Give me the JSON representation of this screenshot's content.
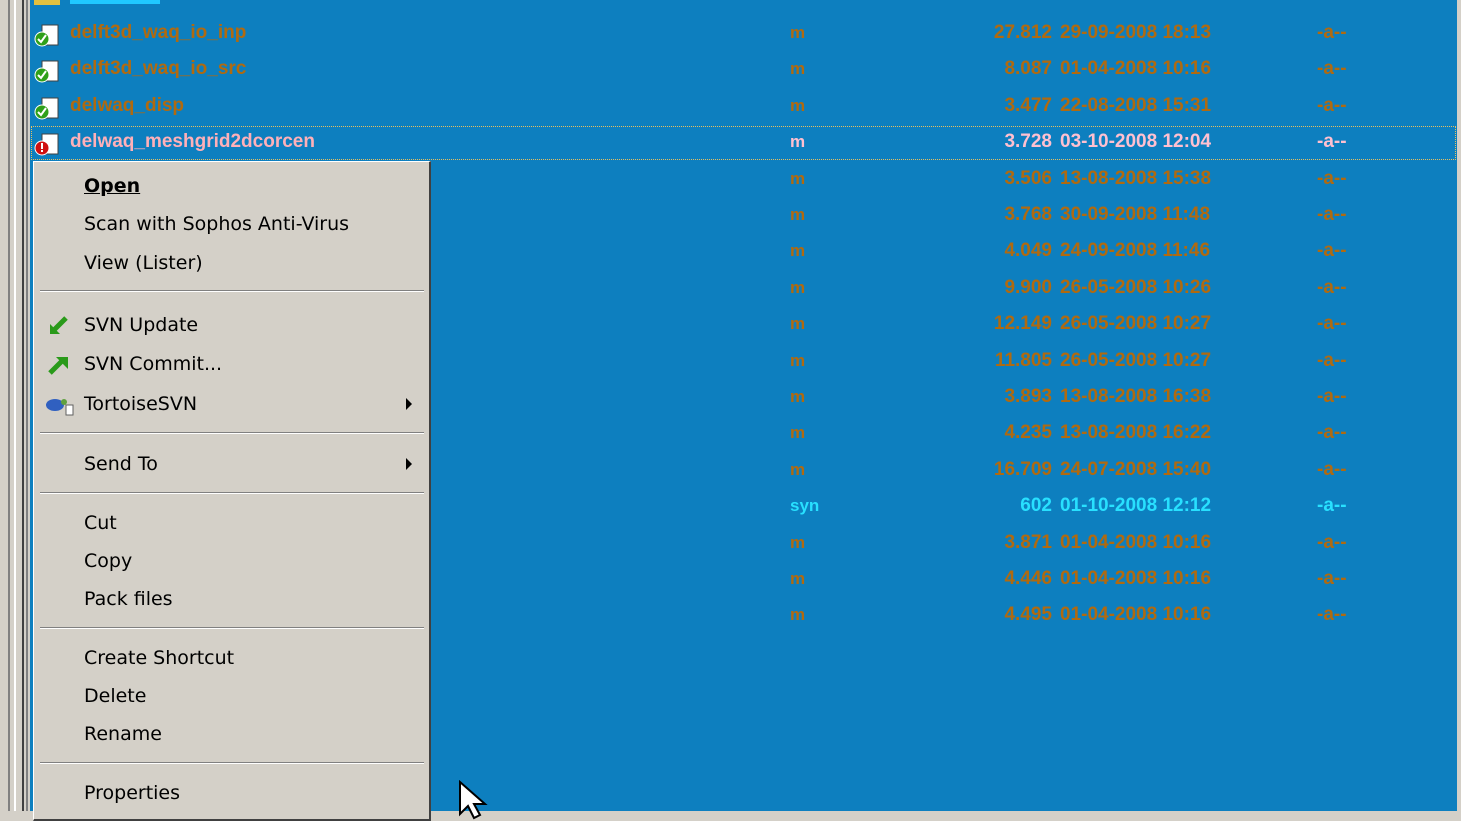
{
  "file_rows": [
    {
      "name": "delft3d_waq_io_inp",
      "ext": "m",
      "size": "27.812",
      "date": "29-09-2008 18:13",
      "attr": "-a--",
      "icon": "svn-normal-icon"
    },
    {
      "name": "delft3d_waq_io_src",
      "ext": "m",
      "size": "8.087",
      "date": "01-04-2008 10:16",
      "attr": "-a--",
      "icon": "svn-normal-icon"
    },
    {
      "name": "delwaq_disp",
      "ext": "m",
      "size": "3.477",
      "date": "22-08-2008 15:31",
      "attr": "-a--",
      "icon": "svn-normal-icon"
    },
    {
      "name": "delwaq_meshgrid2dcorcen",
      "ext": "m",
      "size": "3.728",
      "date": "03-10-2008 12:04",
      "attr": "-a--",
      "icon": "svn-modified-icon"
    },
    {
      "name": "",
      "ext": "m",
      "size": "3.506",
      "date": "13-08-2008 15:38",
      "attr": "-a--"
    },
    {
      "name": "",
      "ext": "m",
      "size": "3.768",
      "date": "30-09-2008 11:48",
      "attr": "-a--"
    },
    {
      "name": "",
      "ext": "m",
      "size": "4.049",
      "date": "24-09-2008 11:46",
      "attr": "-a--"
    },
    {
      "name": "",
      "ext": "m",
      "size": "9.900",
      "date": "26-05-2008 10:26",
      "attr": "-a--"
    },
    {
      "name": "",
      "ext": "m",
      "size": "12.149",
      "date": "26-05-2008 10:27",
      "attr": "-a--"
    },
    {
      "name": "",
      "ext": "m",
      "size": "11.805",
      "date": "26-05-2008 10:27",
      "attr": "-a--"
    },
    {
      "name": "",
      "ext": "m",
      "size": "3.893",
      "date": "13-08-2008 16:38",
      "attr": "-a--"
    },
    {
      "name": "",
      "ext": "m",
      "size": "4.235",
      "date": "13-08-2008 16:22",
      "attr": "-a--"
    },
    {
      "name": "",
      "ext": "m",
      "size": "16.709",
      "date": "24-07-2008 15:40",
      "attr": "-a--"
    },
    {
      "name": "",
      "ext": "syn",
      "size": "602",
      "date": "01-10-2008 12:12",
      "attr": "-a--"
    },
    {
      "name": "",
      "ext": "m",
      "size": "3.871",
      "date": "01-04-2008 10:16",
      "attr": "-a--"
    },
    {
      "name": "",
      "ext": "m",
      "size": "4.446",
      "date": "01-04-2008 10:16",
      "attr": "-a--"
    },
    {
      "name": "",
      "ext": "m",
      "size": "4.495",
      "date": "01-04-2008 10:16",
      "attr": "-a--"
    }
  ],
  "context_menu": {
    "open": "Open",
    "scan": "Scan with Sophos Anti-Virus",
    "view": "View (Lister)",
    "svn_update": "SVN Update",
    "svn_commit": "SVN Commit...",
    "tortoise": "TortoiseSVN",
    "send_to": "Send To",
    "cut": "Cut",
    "copy": "Copy",
    "pack": "Pack files",
    "create_shortcut": "Create Shortcut",
    "delete": "Delete",
    "rename": "Rename",
    "properties": "Properties"
  },
  "colors": {
    "panel_bg": "#0d7fbf",
    "file_text": "#b06a10",
    "cursor_text": "#ffb0b8",
    "syn_text": "#28e0ff",
    "menu_bg": "#d4d0c8"
  }
}
